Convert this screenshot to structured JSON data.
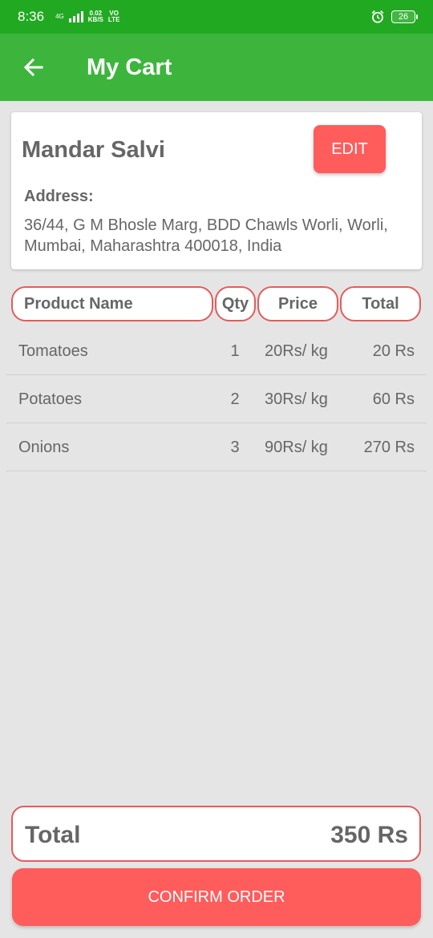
{
  "status_bar": {
    "time": "8:36",
    "network_type": "4G",
    "net_speed_value": "0.02",
    "net_speed_unit": "KB/S",
    "volte_top": "VO",
    "volte_bottom": "LTE",
    "battery": "26"
  },
  "app_bar": {
    "title": "My Cart",
    "back_icon": "arrow-left-icon"
  },
  "address_card": {
    "name": "Mandar Salvi",
    "edit_label": "EDIT",
    "address_label": "Address:",
    "address": "36/44, G M Bhosle Marg, BDD Chawls Worli, Worli, Mumbai, Maharashtra 400018, India"
  },
  "table": {
    "headers": [
      "Product Name",
      "Qty",
      "Price",
      "Total"
    ],
    "rows": [
      {
        "name": "Tomatoes",
        "qty": "1",
        "price": "20Rs/ kg",
        "total": "20 Rs"
      },
      {
        "name": "Potatoes",
        "qty": "2",
        "price": "30Rs/ kg",
        "total": "60 Rs"
      },
      {
        "name": "Onions",
        "qty": "3",
        "price": "90Rs/ kg",
        "total": "270 Rs"
      }
    ]
  },
  "summary": {
    "total_label": "Total",
    "total_value": "350 Rs"
  },
  "confirm_label": "CONFIRM ORDER",
  "colors": {
    "status_bar": "#22a922",
    "app_bar": "#3db53d",
    "accent": "#ff5c5c",
    "pill_border": "#e35c5c",
    "background": "#e5e5e5"
  }
}
